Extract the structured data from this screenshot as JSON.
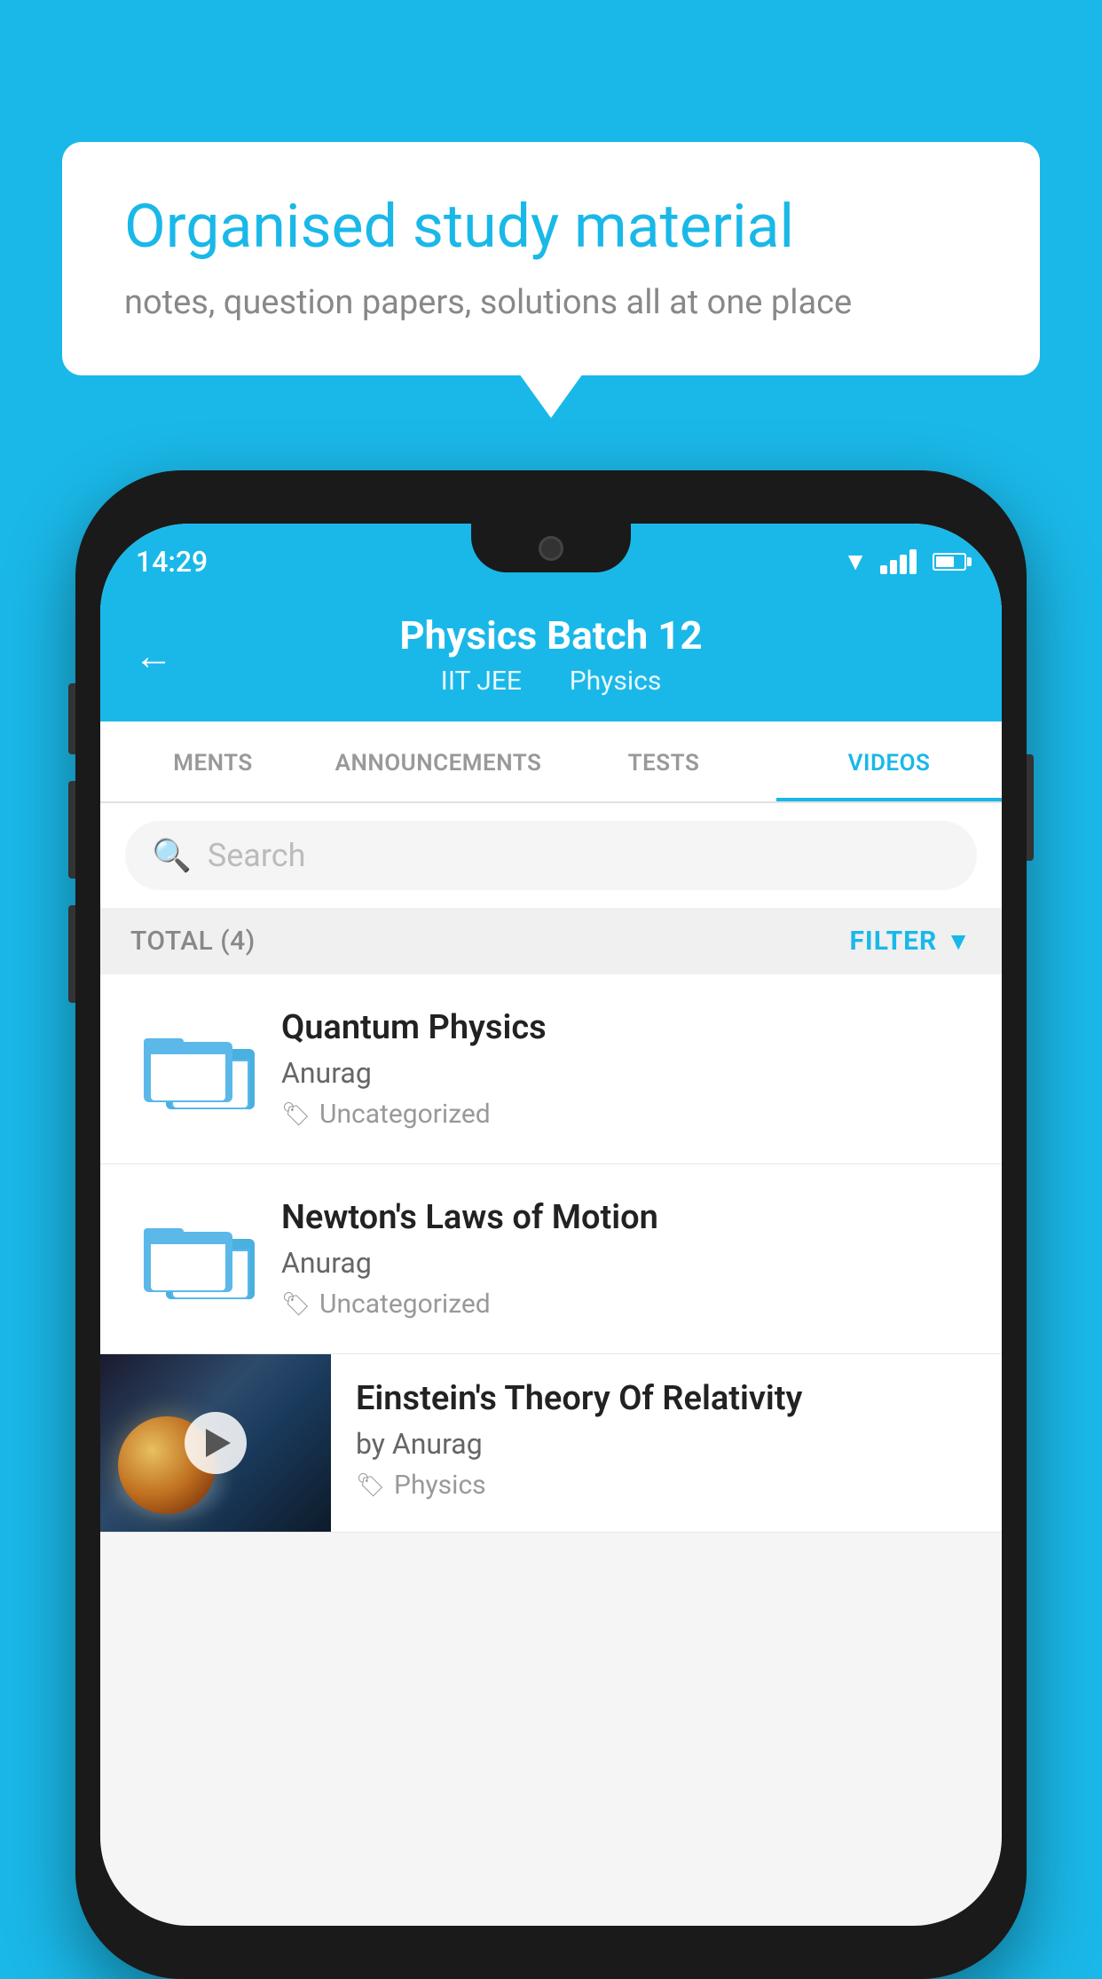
{
  "bubble": {
    "title": "Organised study material",
    "subtitle": "notes, question papers, solutions all at one place"
  },
  "statusBar": {
    "time": "14:29"
  },
  "header": {
    "title": "Physics Batch 12",
    "tag1": "IIT JEE",
    "tag2": "Physics",
    "backLabel": "←"
  },
  "tabs": [
    {
      "label": "MENTS",
      "active": false
    },
    {
      "label": "ANNOUNCEMENTS",
      "active": false
    },
    {
      "label": "TESTS",
      "active": false
    },
    {
      "label": "VIDEOS",
      "active": true
    }
  ],
  "search": {
    "placeholder": "Search"
  },
  "filterRow": {
    "total": "TOTAL (4)",
    "filterLabel": "FILTER"
  },
  "videos": [
    {
      "title": "Quantum Physics",
      "author": "Anurag",
      "tag": "Uncategorized",
      "type": "folder"
    },
    {
      "title": "Newton's Laws of Motion",
      "author": "Anurag",
      "tag": "Uncategorized",
      "type": "folder"
    },
    {
      "title": "Einstein's Theory Of Relativity",
      "author": "by Anurag",
      "tag": "Physics",
      "type": "thumb"
    }
  ]
}
